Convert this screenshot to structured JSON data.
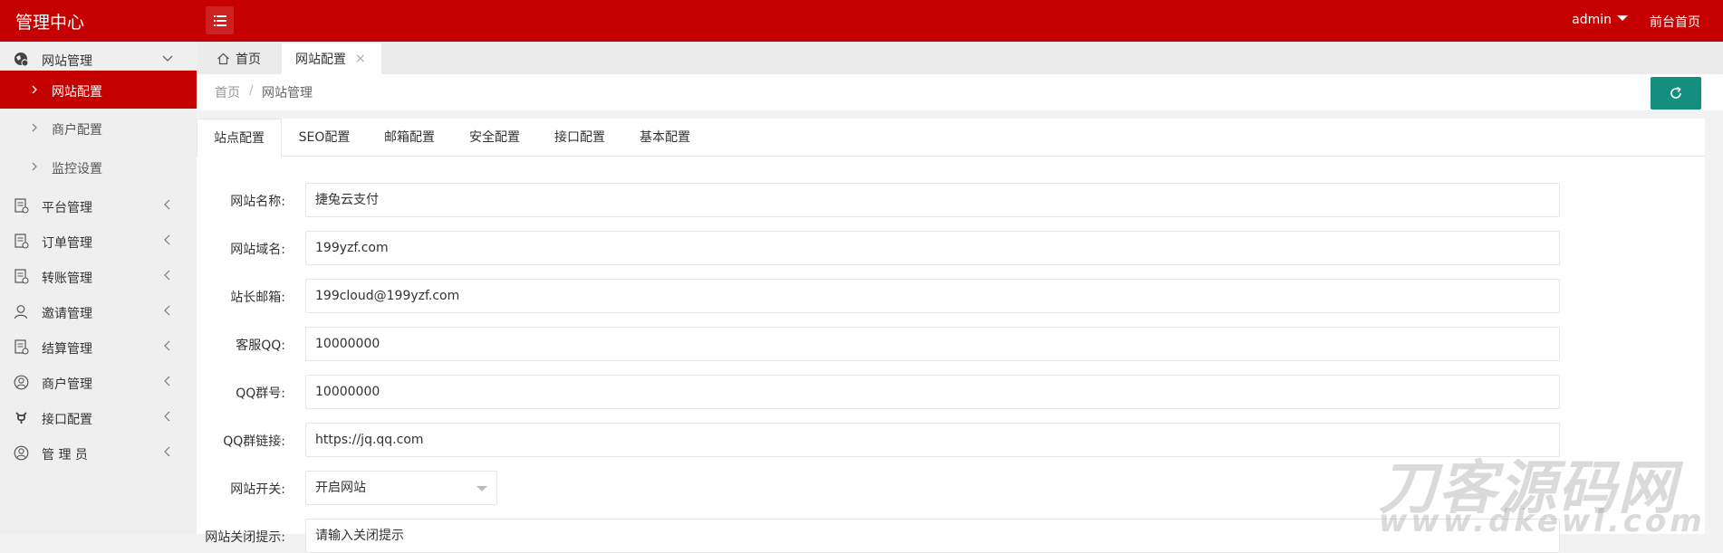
{
  "header": {
    "title": "管理中心",
    "user": "admin",
    "front_link": "前台首页"
  },
  "sidebar": {
    "groups": [
      {
        "label": "网站管理",
        "icon": "website-icon",
        "expanded": true,
        "children": [
          {
            "label": "网站配置",
            "active": true
          },
          {
            "label": "商户配置",
            "active": false
          },
          {
            "label": "监控设置",
            "active": false
          }
        ]
      },
      {
        "label": "平台管理",
        "icon": "document-icon"
      },
      {
        "label": "订单管理",
        "icon": "document-icon"
      },
      {
        "label": "转账管理",
        "icon": "document-icon"
      },
      {
        "label": "邀请管理",
        "icon": "user-icon"
      },
      {
        "label": "结算管理",
        "icon": "document-icon"
      },
      {
        "label": "商户管理",
        "icon": "user-circle-icon"
      },
      {
        "label": "接口配置",
        "icon": "plug-icon"
      },
      {
        "label": "管 理 员",
        "icon": "user-circle-icon"
      }
    ]
  },
  "page_tabs": {
    "home": "首页",
    "current": "网站配置",
    "close": "×"
  },
  "breadcrumb": {
    "home": "首页",
    "separator": "/",
    "current": "网站管理"
  },
  "form_tabs": [
    {
      "label": "站点配置",
      "active": true
    },
    {
      "label": "SEO配置",
      "active": false
    },
    {
      "label": "邮箱配置",
      "active": false
    },
    {
      "label": "安全配置",
      "active": false
    },
    {
      "label": "接口配置",
      "active": false
    },
    {
      "label": "基本配置",
      "active": false
    }
  ],
  "form": {
    "site_name": {
      "label": "网站名称:",
      "value": "捷兔云支付"
    },
    "site_domain": {
      "label": "网站域名:",
      "value": "199yzf.com"
    },
    "admin_email": {
      "label": "站长邮箱:",
      "value": "199cloud@199yzf.com"
    },
    "service_qq": {
      "label": "客服QQ:",
      "value": "10000000"
    },
    "qq_group": {
      "label": "QQ群号:",
      "value": "10000000"
    },
    "qq_group_link": {
      "label": "QQ群链接:",
      "value": "https://jq.qq.com"
    },
    "site_switch": {
      "label": "网站开关:",
      "value": "开启网站"
    },
    "close_notice": {
      "label": "网站关闭提示:",
      "placeholder": "请输入关闭提示"
    }
  },
  "watermark": {
    "line1": "刀客源码网",
    "line2": "www.dkewl.com"
  },
  "colors": {
    "header": "#c50000",
    "active_menu": "#c50000",
    "refresh_button": "#148f7f"
  }
}
